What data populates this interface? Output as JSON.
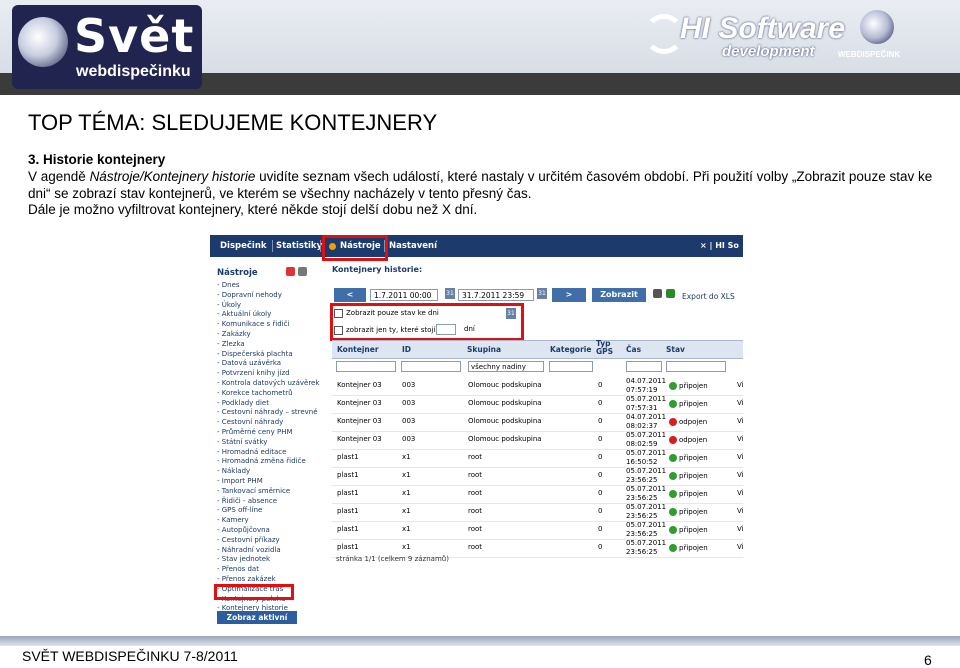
{
  "banner": {
    "logo_left_big": "Svět",
    "logo_left_sub": "webdispečinku",
    "logo_hi": "HI Software",
    "logo_hi_sub": "development",
    "logo_right": "WEBDISPEČINK"
  },
  "slide": {
    "title": "TOP TÉMA: SLEDUJEME KONTEJNERY",
    "heading": "3. Historie kontejnery",
    "p_prefix": "V agendě ",
    "p_italic": "Nástroje/Kontejnery historie",
    "p_rest": " uvidíte seznam všech událostí, které nastaly v určitém časovém období. Při použití volby „Zobrazit pouze stav ke dni“ se zobrazí stav kontejnerů, ve kterém se všechny nacházely v tento přesný čas.",
    "p2": "Dále je možno vyfiltrovat kontejnery, které někde stojí delší dobu než X dní.",
    "footer": "SVĚT WEBDISPEČINKU 7-8/2011",
    "page": "6"
  },
  "app": {
    "topnav": [
      "Dispečink",
      "Statistiky",
      "Nástroje",
      "Nastavení"
    ],
    "topnav_right": "× | HI So",
    "side_heading": "Nástroje",
    "side_items": [
      "- Dnes",
      "- Dopravní nehody",
      "- Úkoly",
      "   - Aktuální úkoly",
      "- Komunikace s řidiči",
      "- Zakázky",
      "- Zlezka",
      "- Dispečerská plachta",
      "- Datová uzávěrka",
      "- Potvrzení knihy jízd",
      "- Kontrola datových uzávěrek",
      "- Korekce tachometrů",
      "- Podklady diet",
      "- Cestovní náhrady – strevné",
      "- Cestovní náhrady",
      "- Průměrné ceny PHM",
      "- Státní svátky",
      "- Hromadná editace",
      "- Hromadná změna řidiče",
      "- Náklady",
      "- Import PHM",
      "- Tankovací směrnice",
      "- Řidiči - absence",
      "- GPS off-line",
      "- Kamery",
      "- Autopůjčovna",
      "- Cestovní příkazy",
      "- Náhradní vozidla",
      "- Stav jednotek",
      "- Přenos dat",
      "- Přenos zakázek",
      "- Optimalizace tras",
      "- Kontejnery poloha",
      "- Kontejnery historie",
      "- Kontejnery detaily"
    ],
    "side_button": "Zobraz aktivní",
    "main_heading": "Kontejnery historie:",
    "prev": "<",
    "next": ">",
    "date_from": "1.7.2011 00:00",
    "date_to": "31.7.2011 23:59",
    "cal": "31",
    "show_button": "Zobrazit",
    "export": "Export do XLS",
    "opt1": "Zobrazit pouze stav ke dni",
    "opt2": "zobrazit jen ty, které stojí",
    "opt2_unit": "dní",
    "columns": [
      "Kontejner",
      "ID",
      "Skupina",
      "Kategorie",
      "Typ GPS",
      "Čas",
      "Stav"
    ],
    "filter_group": "všechny nadiny",
    "rows": [
      {
        "k": "Kontejner 03",
        "id": "003",
        "g": "Olomouc podskupina",
        "t": "0",
        "d1": "04.07.2011",
        "d2": "07:57:19",
        "s": "připojen",
        "ok": true,
        "v": "Vi"
      },
      {
        "k": "Kontejner 03",
        "id": "003",
        "g": "Olomouc podskupina",
        "t": "0",
        "d1": "05.07.2011",
        "d2": "07:57:31",
        "s": "připojen",
        "ok": true,
        "v": "Vi"
      },
      {
        "k": "Kontejner 03",
        "id": "003",
        "g": "Olomouc podskupina",
        "t": "0",
        "d1": "04.07.2011",
        "d2": "08:02:37",
        "s": "odpojen",
        "ok": false,
        "v": "Vi"
      },
      {
        "k": "Kontejner 03",
        "id": "003",
        "g": "Olomouc podskupina",
        "t": "0",
        "d1": "05.07.2011",
        "d2": "08:02:59",
        "s": "odpojen",
        "ok": false,
        "v": "Vi"
      },
      {
        "k": "plast1",
        "id": "x1",
        "g": "root",
        "t": "0",
        "d1": "05.07.2011",
        "d2": "16:50:52",
        "s": "připojen",
        "ok": true,
        "v": "Vi"
      },
      {
        "k": "plast1",
        "id": "x1",
        "g": "root",
        "t": "0",
        "d1": "05.07.2011",
        "d2": "23:56:25",
        "s": "připojen",
        "ok": true,
        "v": "Vi"
      },
      {
        "k": "plast1",
        "id": "x1",
        "g": "root",
        "t": "0",
        "d1": "05.07.2011",
        "d2": "23:56:25",
        "s": "připojen",
        "ok": true,
        "v": "Vi"
      },
      {
        "k": "plast1",
        "id": "x1",
        "g": "root",
        "t": "0",
        "d1": "05.07.2011",
        "d2": "23:56:25",
        "s": "připojen",
        "ok": true,
        "v": "Vi"
      },
      {
        "k": "plast1",
        "id": "x1",
        "g": "root",
        "t": "0",
        "d1": "05.07.2011",
        "d2": "23:56:25",
        "s": "připojen",
        "ok": true,
        "v": "Vi"
      },
      {
        "k": "plast1",
        "id": "x1",
        "g": "root",
        "t": "0",
        "d1": "05.07.2011",
        "d2": "23:56:25",
        "s": "připojen",
        "ok": true,
        "v": "Vi"
      }
    ],
    "pager": "stránka 1/1 (celkem 9 záznamů)"
  },
  "colors": {
    "nav": "#1c3a6b",
    "highlight": "#e01010",
    "ok": "#2f9e2f",
    "bad": "#d42020"
  }
}
